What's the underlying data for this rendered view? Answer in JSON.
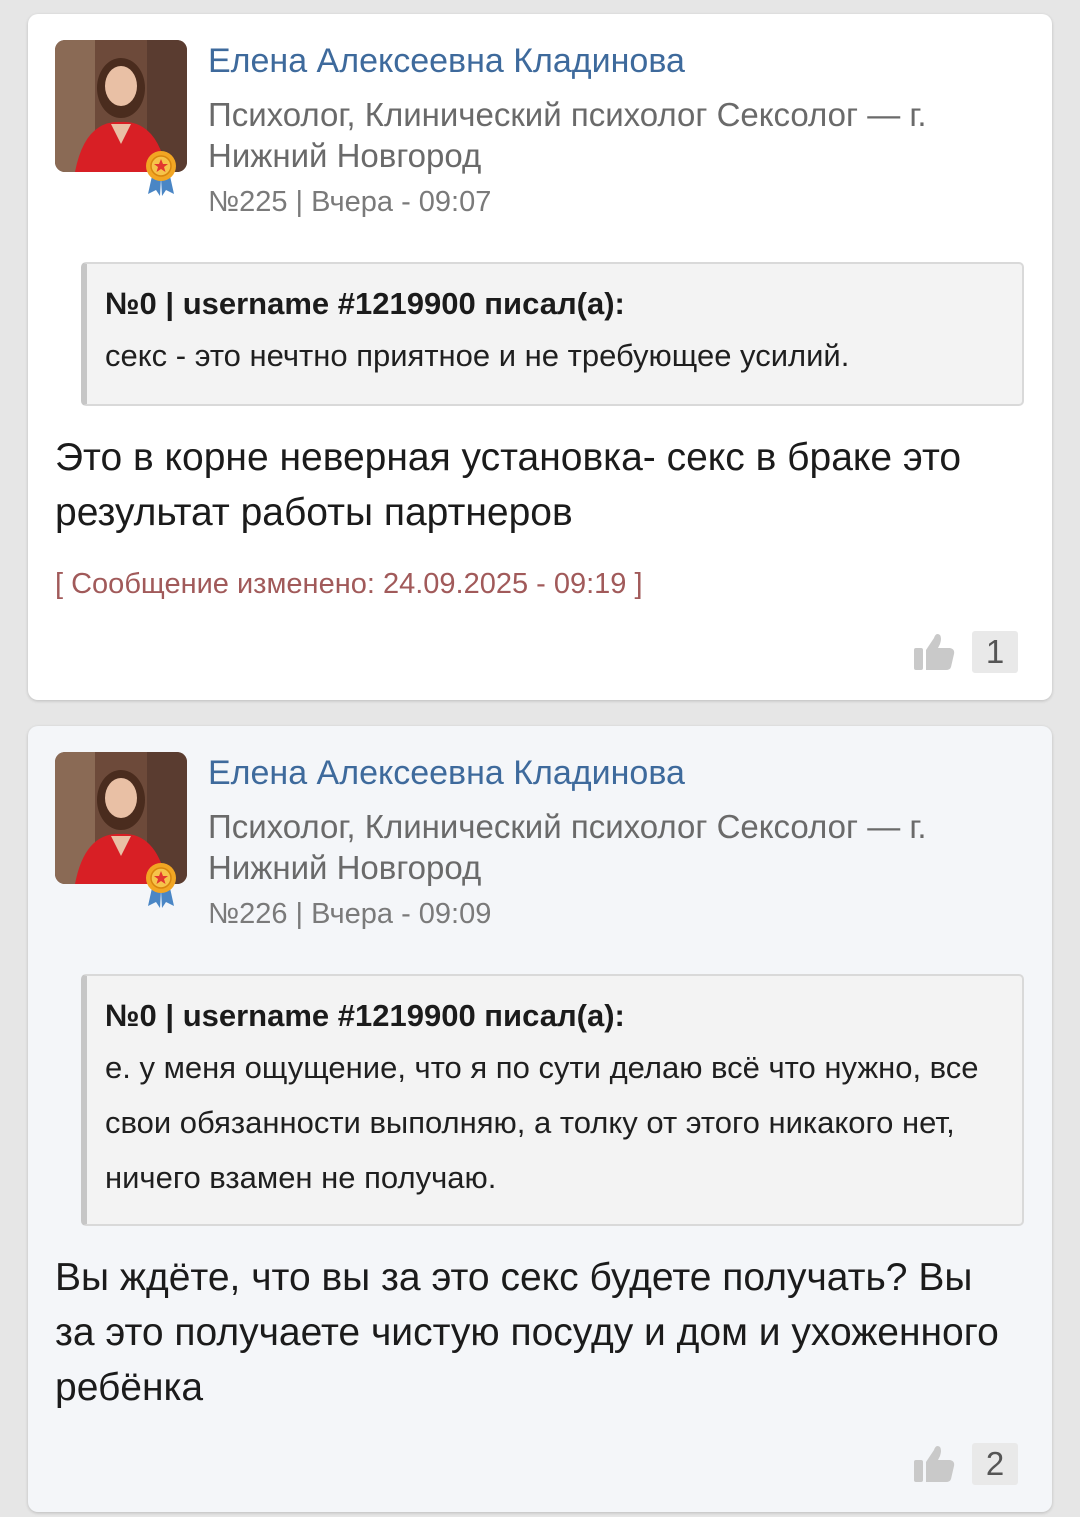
{
  "posts": [
    {
      "author": "Елена Алексеевна Кладинова",
      "role": "Психолог, Клинический психолог Сексолог — г. Нижний Новгород",
      "meta": "№225 | Вчера - 09:07",
      "quote": {
        "header": "№0 | username #1219900 писал(а):",
        "text": "секс - это нечтно приятное и не требующее усилий."
      },
      "body": "Это в корне неверная установка- секс в браке это результат работы партнеров",
      "edited": "[ Сообщение изменено: 24.09.2025 - 09:19 ]",
      "likes": "1"
    },
    {
      "author": "Елена Алексеевна Кладинова",
      "role": "Психолог, Клинический психолог Сексолог — г. Нижний Новгород",
      "meta": "№226 | Вчера - 09:09",
      "quote": {
        "header": "№0 | username #1219900 писал(а):",
        "text": "е. у меня ощущение, что я по сути делаю всё что нужно, все свои обязанности выполняю, а толку от этого никакого нет, ничего взамен не получаю."
      },
      "body": "Вы ждёте, что вы за это секс будете получать? Вы за это получаете чистую посуду и дом и ухоженного ребёнка",
      "likes": "2"
    }
  ],
  "icons": {
    "avatar": "avatar-photo",
    "badge": "award-ribbon-icon",
    "like": "thumbs-up-icon"
  },
  "colors": {
    "author": "#3e6a9c",
    "edited": "#a15a5a",
    "card_alt_background": "#f4f6f9"
  }
}
